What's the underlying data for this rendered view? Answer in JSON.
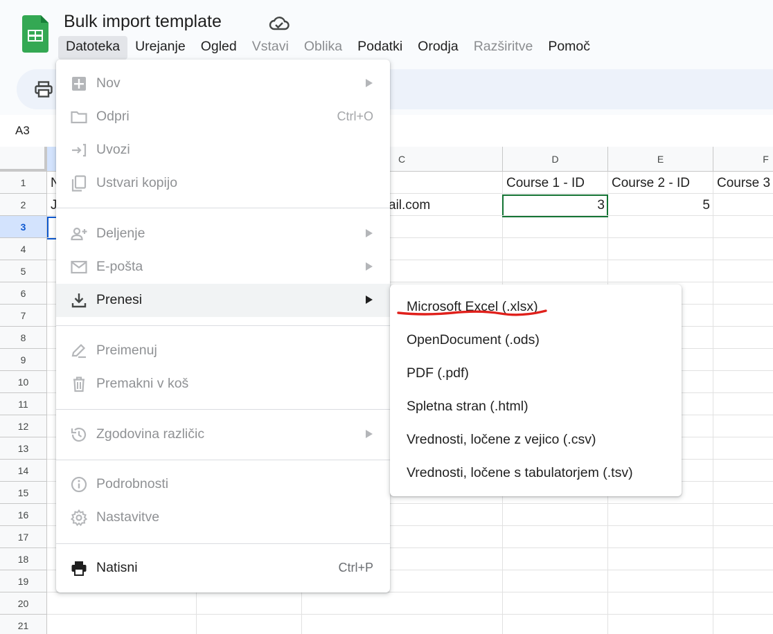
{
  "document": {
    "title": "Bulk import template"
  },
  "menubar": {
    "items": [
      {
        "label": "Datoteka",
        "state": "active"
      },
      {
        "label": "Urejanje",
        "state": "normal"
      },
      {
        "label": "Ogled",
        "state": "normal"
      },
      {
        "label": "Vstavi",
        "state": "disabled"
      },
      {
        "label": "Oblika",
        "state": "disabled"
      },
      {
        "label": "Podatki",
        "state": "normal"
      },
      {
        "label": "Orodja",
        "state": "normal"
      },
      {
        "label": "Razširitve",
        "state": "disabled"
      },
      {
        "label": "Pomoč",
        "state": "normal"
      }
    ]
  },
  "name_box": {
    "value": "A3"
  },
  "grid": {
    "column_headers": [
      "C",
      "D",
      "E",
      "F"
    ],
    "row_numbers": [
      "1",
      "2",
      "3",
      "4",
      "5",
      "6",
      "7",
      "8",
      "9",
      "10",
      "11",
      "12",
      "13",
      "14",
      "15",
      "16",
      "17",
      "18",
      "19",
      "20",
      "21"
    ],
    "selected_row": "3",
    "cells": {
      "A1_partial": "N",
      "A2_partial": "J",
      "C2": "ail.com",
      "D1": "Course 1 - ID",
      "E1": "Course 2 - ID",
      "F1": "Course 3",
      "D2": "3",
      "E2": "5"
    }
  },
  "file_menu": {
    "items": {
      "new": {
        "label": "Nov",
        "icon": "new-sheet-icon"
      },
      "open": {
        "label": "Odpri",
        "shortcut": "Ctrl+O",
        "icon": "folder-icon"
      },
      "import": {
        "label": "Uvozi",
        "icon": "import-icon"
      },
      "copy": {
        "label": "Ustvari kopijo",
        "icon": "copy-icon"
      },
      "share": {
        "label": "Deljenje",
        "icon": "share-icon"
      },
      "email": {
        "label": "E-pošta",
        "icon": "email-icon"
      },
      "download": {
        "label": "Prenesi",
        "icon": "download-icon"
      },
      "rename": {
        "label": "Preimenuj",
        "icon": "rename-icon"
      },
      "trash": {
        "label": "Premakni v koš",
        "icon": "trash-icon"
      },
      "history": {
        "label": "Zgodovina različic",
        "icon": "history-icon"
      },
      "details": {
        "label": "Podrobnosti",
        "icon": "info-icon"
      },
      "settings": {
        "label": "Nastavitve",
        "icon": "gear-icon"
      },
      "print": {
        "label": "Natisni",
        "shortcut": "Ctrl+P",
        "icon": "print-icon"
      }
    }
  },
  "download_submenu": {
    "items": [
      {
        "label": "Microsoft Excel (.xlsx)"
      },
      {
        "label": "OpenDocument (.ods)"
      },
      {
        "label": "PDF (.pdf)"
      },
      {
        "label": "Spletna stran (.html)"
      },
      {
        "label": "Vrednosti, ločene z vejico (.csv)"
      },
      {
        "label": "Vrednosti, ločene s tabulatorjem (.tsv)"
      }
    ]
  },
  "colors": {
    "annotation_red": "#e0201b",
    "active_cell_border": "#137333",
    "selection_blue": "#0b57d0",
    "logo_green": "#34a853"
  }
}
